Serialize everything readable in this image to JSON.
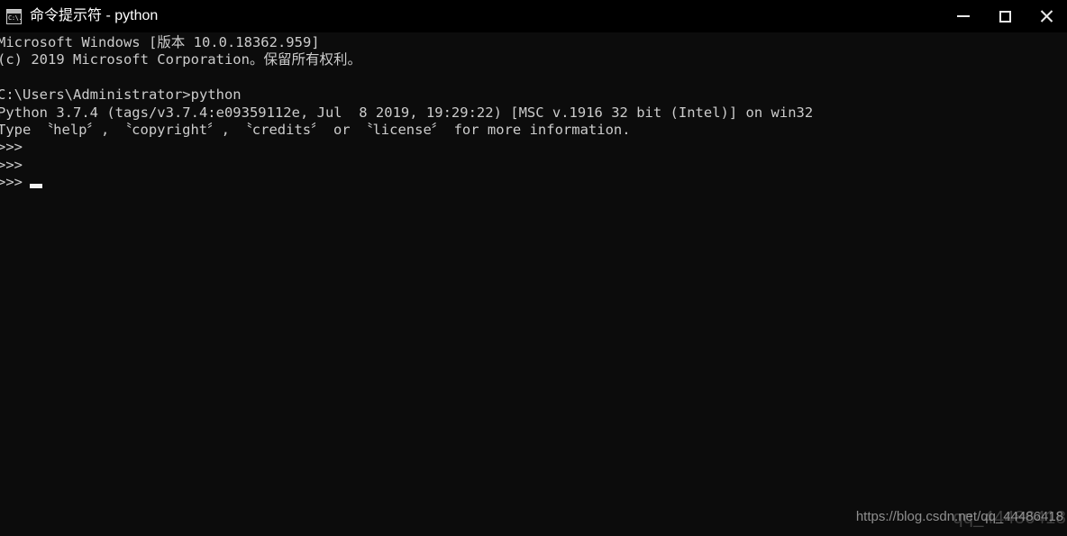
{
  "window": {
    "title": "命令提示符 - python",
    "icon": "cmd-console-icon",
    "icon_text": "C:\\.",
    "background_color": "#0c0c0c",
    "titlebar_color": "#000000",
    "text_color": "#cccccc"
  },
  "titlebar": {
    "buttons": [
      {
        "name": "minimize",
        "label": "minimize-icon"
      },
      {
        "name": "maximize",
        "label": "maximize-icon"
      },
      {
        "name": "close",
        "label": "close-icon"
      }
    ]
  },
  "console": {
    "lines": [
      "Microsoft Windows [版本 10.0.18362.959]",
      "(c) 2019 Microsoft Corporation。保留所有权利。",
      "",
      "C:\\Users\\Administrator>python",
      "Python 3.7.4 (tags/v3.7.4:e09359112e, Jul  8 2019, 19:29:22) [MSC v.1916 32 bit (Intel)] on win32",
      "Type 〝help〞, 〝copyright〞, 〝credits〞 or 〝license〞 for more information.",
      ">>>",
      ">>>",
      ">>>"
    ],
    "cursor_line_prompt": ">>> ",
    "cursor_visible": true
  },
  "watermark": {
    "sharp_text": "https://blog.csdn.net/qq_44486418",
    "faint_text": "qq_44486418"
  }
}
